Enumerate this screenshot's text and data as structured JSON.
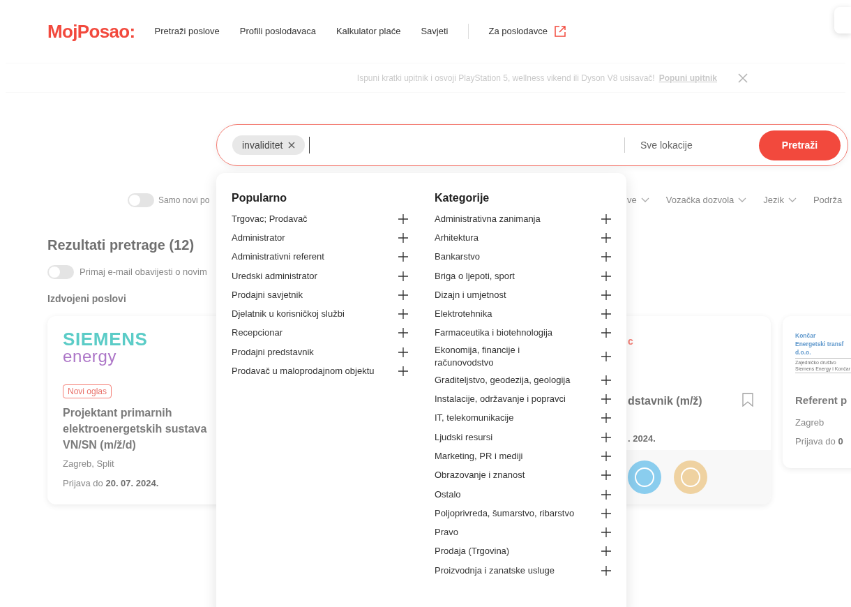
{
  "header": {
    "logo": "MojPosao:",
    "nav": [
      "Pretraži poslove",
      "Profili poslodavaca",
      "Kalkulator plaće",
      "Savjeti"
    ],
    "employer_link": "Za poslodavce"
  },
  "banner": {
    "text": "Ispuni kratki upitnik i osvoji PlayStation 5, wellness vikend ili Dyson V8 usisavač!",
    "link": "Popuni upitnik"
  },
  "search": {
    "chips": [
      {
        "label": "invaliditet"
      }
    ],
    "location": "Sve lokacije",
    "button": "Pretraži"
  },
  "filters": {
    "new_only": {
      "label": "Samo novi po",
      "on": false
    },
    "dropdowns": [
      "ve",
      "Vozačka dozvola",
      "Jezik",
      "Podrža"
    ]
  },
  "results": {
    "title": "Rezultati pretrage (12)",
    "email_alerts": {
      "label": "Primaj e-mail obavijesti o novim",
      "on": false
    },
    "featured_title": "Izdvojeni poslovi",
    "cards": [
      {
        "logo": [
          "SIEMENS",
          "energy"
        ],
        "badge": "Novi oglas",
        "title": "Projektant primarnih elektroenergetskih sustava VN/SN (m/ž/d)",
        "location": "Zagreb, Split",
        "deadline_label": "Prijava do",
        "deadline": "20. 07. 2024."
      },
      {
        "logo": [
          "c"
        ],
        "title": "dstavnik (m/ž)",
        "deadline": ". 2024.",
        "bookmark": false
      },
      {
        "logo": [
          "Končar",
          "Energetski transf",
          "d.o.o."
        ],
        "logo_note": [
          "Zajedničko društvo",
          "Siemens Energy i Končar"
        ],
        "title": "Referent p",
        "location": "Zagreb",
        "deadline_label": "Prijava do",
        "deadline": "0"
      }
    ]
  },
  "suggestions": {
    "columns": [
      {
        "title": "Popularno",
        "items": [
          "Trgovac; Prodavač",
          "Administrator",
          "Administrativni referent",
          "Uredski administrator",
          "Prodajni savjetnik",
          "Djelatnik u korisničkoj službi",
          "Recepcionar",
          "Prodajni predstavnik",
          "Prodavač u maloprodajnom objektu"
        ]
      },
      {
        "title": "Kategorije",
        "items": [
          "Administrativna zanimanja",
          "Arhitektura",
          "Bankarstvo",
          "Briga o ljepoti, sport",
          "Dizajn i umjetnost",
          "Elektrotehnika",
          "Farmaceutika i biotehnologija",
          "Ekonomija, financije i računovodstvo",
          "Graditeljstvo, geodezija, geologija",
          "Instalacije, održavanje i popravci",
          "IT, telekomunikacije",
          "Ljudski resursi",
          "Marketing, PR i mediji",
          "Obrazovanje i znanost",
          "Ostalo",
          "Poljoprivreda, šumarstvo, ribarstvo",
          "Pravo",
          "Prodaja (Trgovina)",
          "Proizvodnja i zanatske usluge"
        ]
      }
    ]
  }
}
